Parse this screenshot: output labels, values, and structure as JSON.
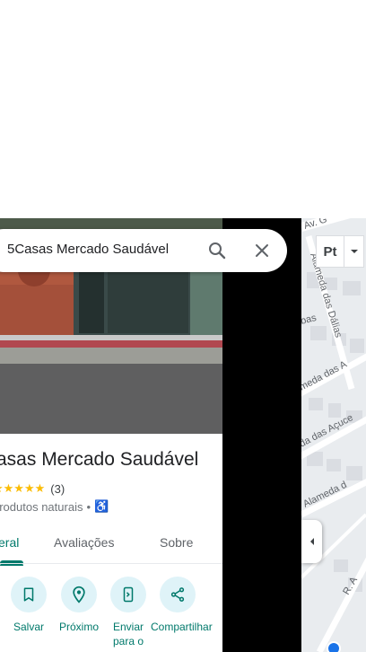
{
  "search": {
    "query": "5Casas Mercado Saudável"
  },
  "map_controls": {
    "layer_label": "Pt"
  },
  "place": {
    "name": "asas Mercado Saudável",
    "stars": "★★★★★",
    "review_count": "(3)",
    "rating": 5,
    "category": "produtos naturais",
    "separator": "•",
    "accessibility_glyph": "♿"
  },
  "tabs": [
    {
      "label": "eral",
      "active": true
    },
    {
      "label": "Avaliações",
      "active": false
    },
    {
      "label": "Sobre",
      "active": false
    }
  ],
  "actions": [
    {
      "label": "Salvar",
      "icon": "bookmark-icon"
    },
    {
      "label": "Próximo",
      "icon": "nearby-icon"
    },
    {
      "label": "Enviar para o",
      "icon": "send-to-phone-icon"
    },
    {
      "label": "Compartilhar",
      "icon": "share-icon"
    }
  ],
  "map_labels": {
    "street_1": "Alameda das Dálias",
    "street_2": "meda das A",
    "street_3": "da das Açuce",
    "street_4": "Alameda d",
    "street_5": "bas",
    "street_6": "R. A",
    "street_7": "Av. G"
  },
  "colors": {
    "accent": "#00796b",
    "star": "#fbbc04",
    "action_bg": "#dff3f8",
    "map_bg": "#eceff3",
    "link_blue": "#1a73e8"
  }
}
